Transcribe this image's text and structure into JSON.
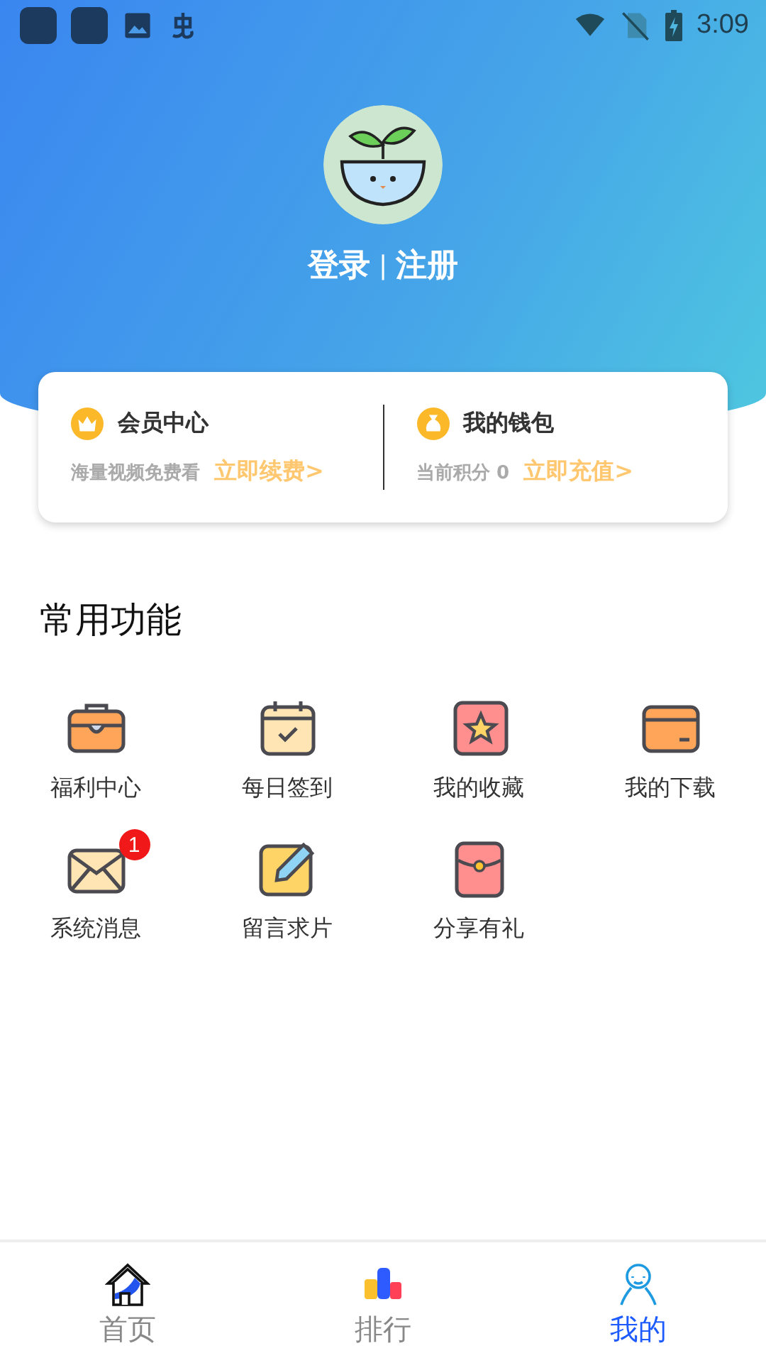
{
  "status_bar": {
    "time": "3:09"
  },
  "profile": {
    "login": "登录",
    "separator": "|",
    "register": "注册"
  },
  "cards": [
    {
      "kind": "vip",
      "title": "会员中心",
      "subtitle": "海量视频免费看",
      "action": "立即续费>"
    },
    {
      "kind": "wallet",
      "title": "我的钱包",
      "subtitle": "当前积分 0",
      "action": "立即充值>"
    }
  ],
  "section_title": "常用功能",
  "features": [
    {
      "kind": "toolbox",
      "label": "福利中心"
    },
    {
      "kind": "calendar",
      "label": "每日签到"
    },
    {
      "kind": "star",
      "label": "我的收藏"
    },
    {
      "kind": "card",
      "label": "我的下载"
    },
    {
      "kind": "mail",
      "label": "系统消息",
      "badge": "1"
    },
    {
      "kind": "note",
      "label": "留言求片"
    },
    {
      "kind": "redpacket",
      "label": "分享有礼"
    }
  ],
  "nav": [
    {
      "kind": "home",
      "label": "首页",
      "selected": false
    },
    {
      "kind": "rank",
      "label": "排行",
      "selected": false
    },
    {
      "kind": "person",
      "label": "我的",
      "selected": true
    }
  ]
}
